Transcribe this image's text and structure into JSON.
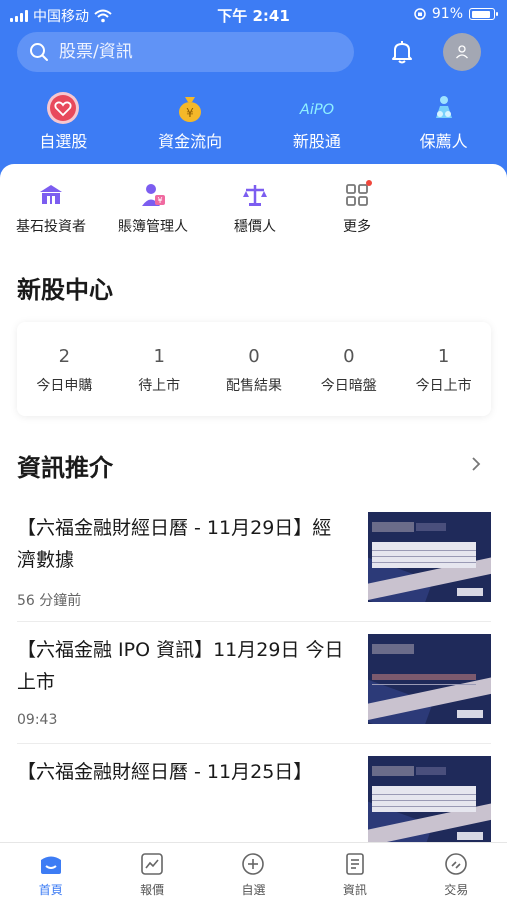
{
  "status_bar": {
    "carrier": "中国移动",
    "time": "下午 2:41",
    "battery": "91%",
    "battery_level": 0.91
  },
  "search": {
    "placeholder": "股票/資訊"
  },
  "quick_nav": [
    {
      "label": "自選股",
      "icon": "heart-icon"
    },
    {
      "label": "資金流向",
      "icon": "money-bag-icon"
    },
    {
      "label": "新股通",
      "icon": "aipo-icon"
    },
    {
      "label": "保薦人",
      "icon": "sponsor-icon"
    }
  ],
  "sub_nav": [
    {
      "label": "基石投資者",
      "icon": "bank-icon"
    },
    {
      "label": "賬簿管理人",
      "icon": "manager-icon"
    },
    {
      "label": "穩價人",
      "icon": "scale-icon"
    },
    {
      "label": "更多",
      "icon": "grid-icon"
    }
  ],
  "ipo_center": {
    "title": "新股中心",
    "items": [
      {
        "value": "2",
        "label": "今日申購"
      },
      {
        "value": "1",
        "label": "待上市"
      },
      {
        "value": "0",
        "label": "配售結果"
      },
      {
        "value": "0",
        "label": "今日暗盤"
      },
      {
        "value": "1",
        "label": "今日上市"
      }
    ]
  },
  "news_section": {
    "title": "資訊推介",
    "items": [
      {
        "title": "【六福金融財經日曆 - 11月29日】經濟數據",
        "time": "56 分鐘前"
      },
      {
        "title": "【六福金融 IPO 資訊】11月29日 今日上市",
        "time": "09:43"
      },
      {
        "title": "【六福金融財經日曆 - 11月25日】",
        "time": ""
      }
    ]
  },
  "tab_bar": [
    {
      "label": "首頁",
      "icon": "home-icon",
      "active": true
    },
    {
      "label": "報價",
      "icon": "chart-icon",
      "active": false
    },
    {
      "label": "自選",
      "icon": "add-circle-icon",
      "active": false
    },
    {
      "label": "資訊",
      "icon": "news-icon",
      "active": false
    },
    {
      "label": "交易",
      "icon": "trade-icon",
      "active": false
    }
  ],
  "colors": {
    "primary": "#3d7cf4",
    "badge": "#f0473c"
  }
}
